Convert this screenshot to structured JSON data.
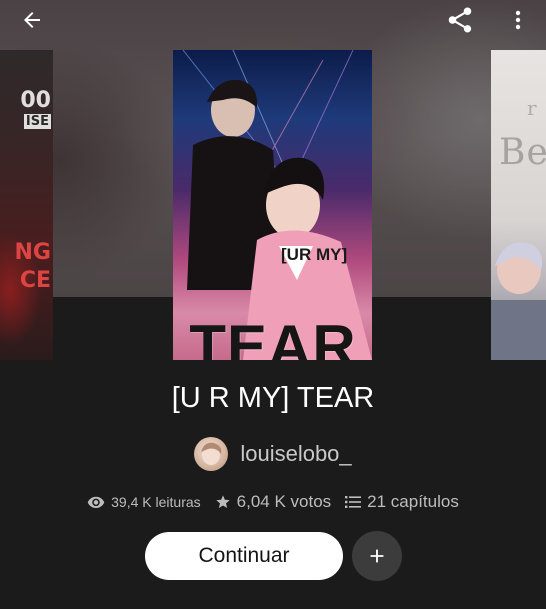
{
  "toolbar": {
    "back_icon": "arrow-left-icon",
    "share_icon": "share-icon",
    "more_icon": "more-vertical-icon"
  },
  "covers": {
    "left_partial_text": [
      "00",
      "ISE",
      "NG",
      "CE"
    ],
    "main_overlay_sub": "[UR MY]",
    "main_overlay_title": "TEAR",
    "right_partial_text": "Be",
    "right_partial_small": "r"
  },
  "book": {
    "title": "[U R MY] TEAR",
    "author": "louiselobo_"
  },
  "stats": {
    "reads": "39,4 K leituras",
    "votes": "6,04 K votos",
    "parts": "21 capítulos"
  },
  "actions": {
    "continue_label": "Continuar",
    "add_icon": "plus-icon"
  },
  "colors": {
    "background": "#1b1b1b",
    "primary_button": "#ffffff",
    "secondary_button": "#3c3c3c",
    "muted_text": "#bdbdbd"
  }
}
